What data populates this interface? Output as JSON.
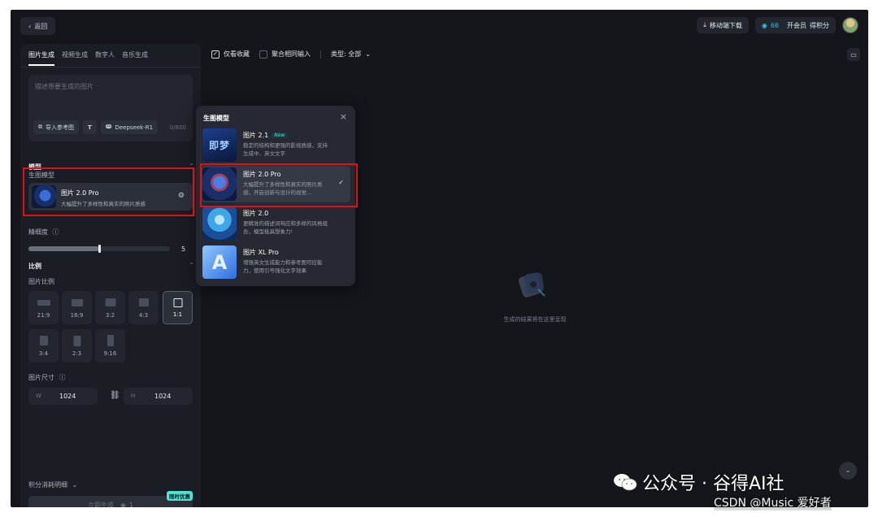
{
  "topbar": {
    "back_label": "返回",
    "mobile_download": "移动端下载",
    "credits": "66",
    "vip": "开会员",
    "points": "得积分"
  },
  "left": {
    "tabs": [
      {
        "label": "图片生成",
        "active": true
      },
      {
        "label": "视频生成",
        "active": false
      },
      {
        "label": "数字人",
        "active": false
      },
      {
        "label": "音乐生成",
        "active": false
      }
    ],
    "prompt_placeholder": "描述想要生成的图片",
    "import_ref": "导入参考图",
    "text_tool": "T",
    "deepseek": "Deepseek-R1",
    "counter": "0/800",
    "model_section": "模型",
    "model_label": "生图模型",
    "selected_model": {
      "name": "图片 2.0 Pro",
      "desc": "大幅提升了多样性和真实的照片质感"
    },
    "precision_label": "精细度",
    "precision_value": "5",
    "precision_fraction": 0.5,
    "ratio_section": "比例",
    "ratio_label": "图片比例",
    "ratios": [
      "21:9",
      "16:9",
      "3:2",
      "4:3",
      "1:1",
      "3:4",
      "2:3",
      "9:16"
    ],
    "selected_ratio": "1:1",
    "size_label": "图片尺寸",
    "width_label": "W",
    "width_value": "1024",
    "height_label": "H",
    "height_value": "1024",
    "cost_label": "积分消耗明细",
    "generate_label": "立即生成",
    "generate_cost": "1",
    "promo_badge": "限时优惠"
  },
  "workspace": {
    "only_fav": "仅看收藏",
    "merge_same": "聚合相同输入",
    "type_filter": "类型: 全部",
    "empty_text": "生成的结果将在这里呈现"
  },
  "popup": {
    "title": "生图模型",
    "new_tag": "New",
    "models": [
      {
        "name": "图片 2.1",
        "desc": "稳定的结构和更强的影视质感，支持生成中、英文文字",
        "new": true,
        "selected": false
      },
      {
        "name": "图片 2.0 Pro",
        "desc": "大幅提升了多样性和真实的照片质感，开启创新与设计的视觉...",
        "new": false,
        "selected": true
      },
      {
        "name": "图片 2.0",
        "desc": "更精准的描述词响应和多样的风格组合，模型极具想象力!",
        "new": false,
        "selected": false
      },
      {
        "name": "图片 XL Pro",
        "desc": "增强英文生成能力和参考图可控能力，使用引号强化文字效果",
        "new": false,
        "selected": false
      }
    ],
    "thumb1_text": "即梦"
  },
  "watermark": {
    "line1": "公众号 · 谷得AI社",
    "line2": "CSDN @Music 爱好者"
  },
  "colors": {
    "accent_cyan": "#2ec7e6",
    "highlight_red": "#e0101a",
    "panel_bg": "#1a1d24",
    "app_bg": "#14161c"
  }
}
